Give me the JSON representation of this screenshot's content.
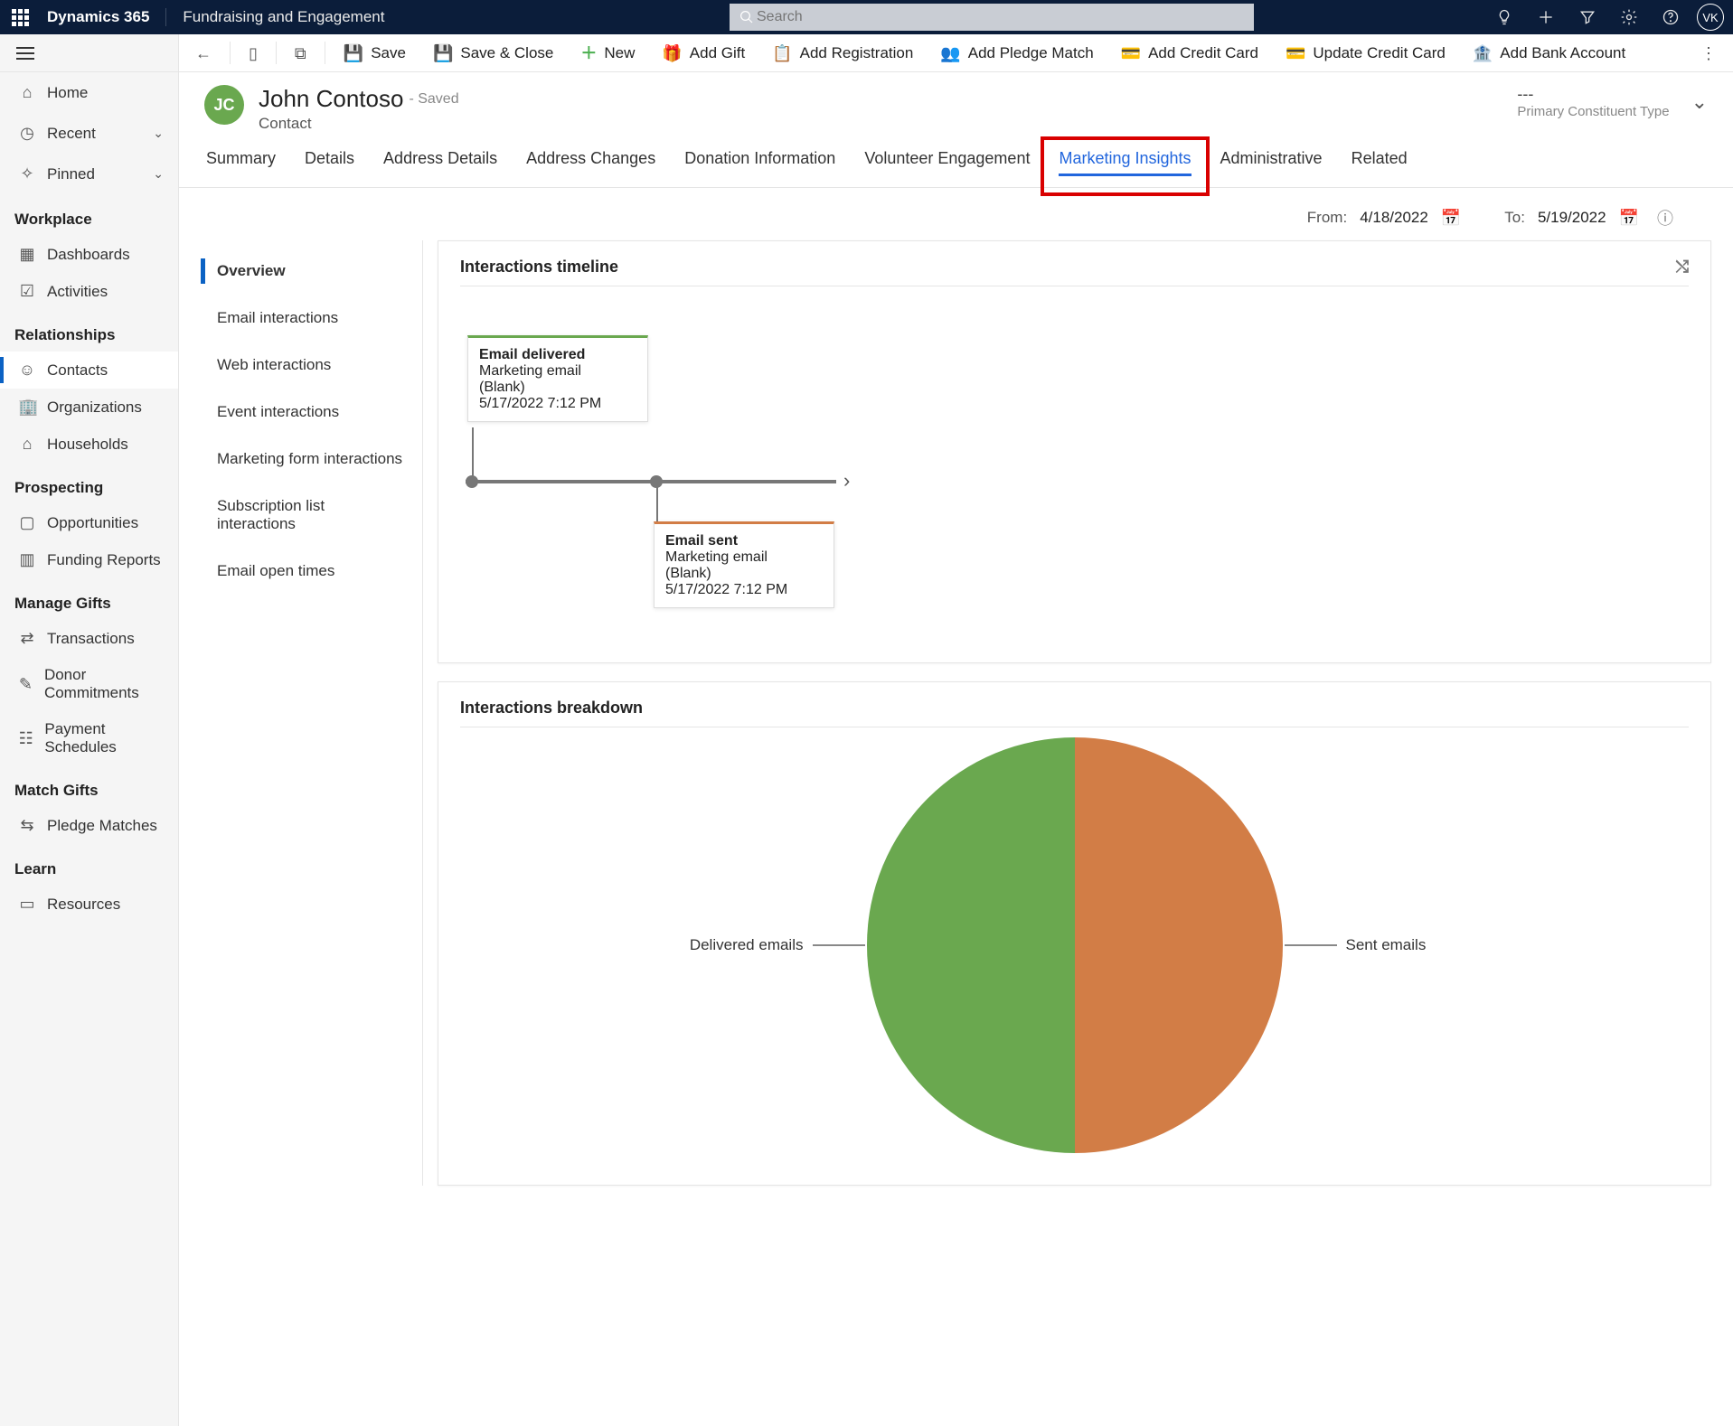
{
  "nav": {
    "brand": "Dynamics 365",
    "module": "Fundraising and Engagement",
    "search_placeholder": "Search",
    "avatar_initials": "VK"
  },
  "commands": {
    "back": "Back",
    "save": "Save",
    "save_close": "Save & Close",
    "new": "New",
    "add_gift": "Add Gift",
    "add_registration": "Add Registration",
    "add_pledge_match": "Add Pledge Match",
    "add_credit_card": "Add Credit Card",
    "update_credit_card": "Update Credit Card",
    "add_bank_account": "Add Bank Account"
  },
  "sidebar": {
    "quick": {
      "home": "Home",
      "recent": "Recent",
      "pinned": "Pinned"
    },
    "groups": [
      {
        "title": "Workplace",
        "items": [
          "Dashboards",
          "Activities"
        ]
      },
      {
        "title": "Relationships",
        "items": [
          "Contacts",
          "Organizations",
          "Households"
        ],
        "active_index": 0
      },
      {
        "title": "Prospecting",
        "items": [
          "Opportunities",
          "Funding Reports"
        ]
      },
      {
        "title": "Manage Gifts",
        "items": [
          "Transactions",
          "Donor Commitments",
          "Payment Schedules"
        ]
      },
      {
        "title": "Match Gifts",
        "items": [
          "Pledge Matches"
        ]
      },
      {
        "title": "Learn",
        "items": [
          "Resources"
        ]
      }
    ]
  },
  "record": {
    "initials": "JC",
    "name": "John Contoso",
    "saved_label": "- Saved",
    "entity": "Contact",
    "right_value": "---",
    "right_label": "Primary Constituent Type"
  },
  "tabs": [
    "Summary",
    "Details",
    "Address Details",
    "Address Changes",
    "Donation Information",
    "Volunteer Engagement",
    "Marketing Insights",
    "Administrative",
    "Related"
  ],
  "active_tab": 6,
  "date_range": {
    "from_label": "From:",
    "from": "4/18/2022",
    "to_label": "To:",
    "to": "5/19/2022"
  },
  "insights_nav": [
    "Overview",
    "Email interactions",
    "Web interactions",
    "Event interactions",
    "Marketing form interactions",
    "Subscription list interactions",
    "Email open times"
  ],
  "insights_active": 0,
  "timeline": {
    "title": "Interactions timeline",
    "events": [
      {
        "kind": "delivered",
        "title": "Email delivered",
        "line1": "Marketing email",
        "line2": "(Blank)",
        "when": "5/17/2022 7:12 PM"
      },
      {
        "kind": "sent",
        "title": "Email sent",
        "line1": "Marketing email",
        "line2": "(Blank)",
        "when": "5/17/2022 7:12 PM"
      }
    ]
  },
  "breakdown": {
    "title": "Interactions breakdown",
    "left_label": "Delivered emails",
    "right_label": "Sent emails"
  },
  "chart_data": {
    "type": "pie",
    "title": "Interactions breakdown",
    "series": [
      {
        "name": "Delivered emails",
        "value": 1,
        "color": "#6aa84f"
      },
      {
        "name": "Sent emails",
        "value": 1,
        "color": "#d27d46"
      }
    ]
  }
}
